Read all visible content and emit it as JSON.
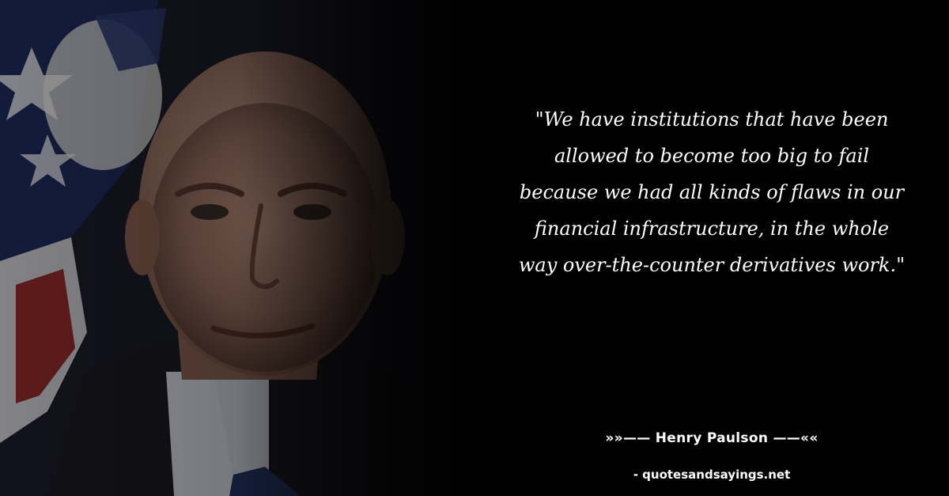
{
  "quote": {
    "text": "\"We have institutions that have been allowed to become too big to fail because we had all kinds of flaws in our financial infrastructure, in the whole way over-the-counter derivatives work.\""
  },
  "attribution": {
    "author_line": "»»—— Henry Paulson ——««"
  },
  "footer": {
    "site": "- quotesandsayings.net"
  },
  "colors": {
    "background": "#000000",
    "text": "#ffffff"
  }
}
